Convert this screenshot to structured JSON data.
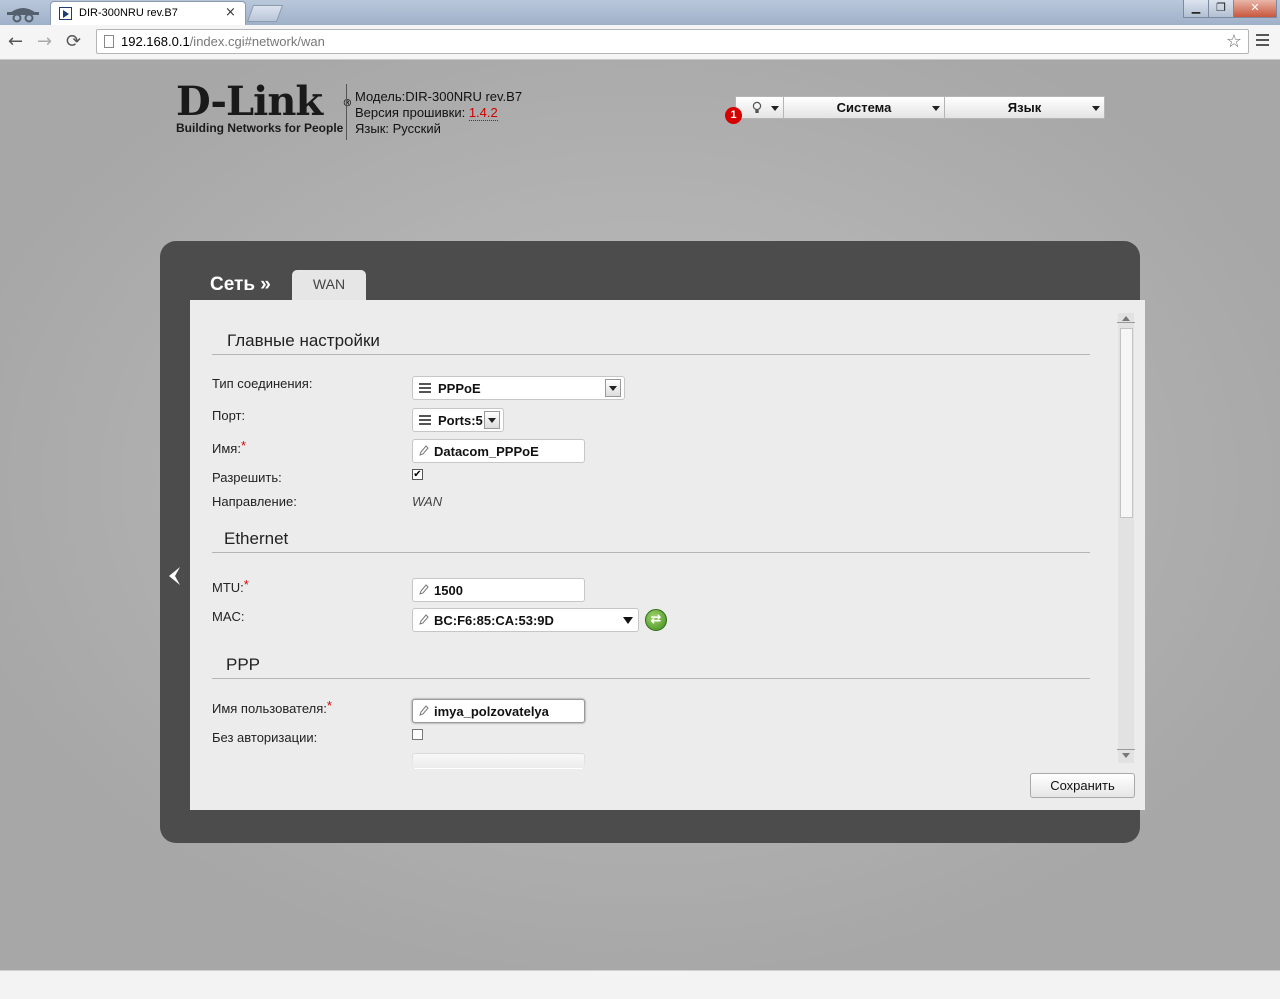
{
  "browser": {
    "tab_title": "DIR-300NRU rev.B7",
    "tab_close": "×",
    "url_host": "192.168.0.1",
    "url_path": "/index.cgi#network/wan",
    "window_buttons": [
      "▁",
      "❐",
      "✕"
    ],
    "nav": {
      "back": "←",
      "forward": "→",
      "reload": "⟳"
    },
    "star": "☆"
  },
  "header": {
    "logo_text": "D-Link",
    "logo_reg": "®",
    "logo_tagline": "Building Networks for People",
    "model_label": "Модель:",
    "model_value": "DIR-300NRU rev.B7",
    "firmware_label": "Версия прошивки:",
    "firmware_value": "1.4.2",
    "language_label": "Язык:",
    "language_value": "Русский",
    "notification_count": "1",
    "menu_system": "Система",
    "menu_language": "Язык"
  },
  "breadcrumb": {
    "section": "Сеть »",
    "tab": "WAN"
  },
  "main_settings": {
    "title": "Главные настройки",
    "connection_type_label": "Тип соединения:",
    "connection_type_value": "PPPoE",
    "port_label": "Порт:",
    "port_value": "Ports:5",
    "name_label": "Имя:",
    "name_value": "Datacom_PPPoE",
    "enable_label": "Разрешить:",
    "enable_checked": true,
    "enable_mark": "✔",
    "direction_label": "Направление:",
    "direction_value": "WAN"
  },
  "ethernet": {
    "title": "Ethernet",
    "mtu_label": "MTU:",
    "mtu_value": "1500",
    "mac_label": "MAC:",
    "mac_value": "BC:F6:85:CA:53:9D"
  },
  "ppp": {
    "title": "PPP",
    "username_label": "Имя пользователя:",
    "username_value": "imya_polzovatelya",
    "no_auth_label": "Без авторизации:",
    "no_auth_checked": false
  },
  "required_mark": "*",
  "actions": {
    "save": "Сохранить"
  }
}
